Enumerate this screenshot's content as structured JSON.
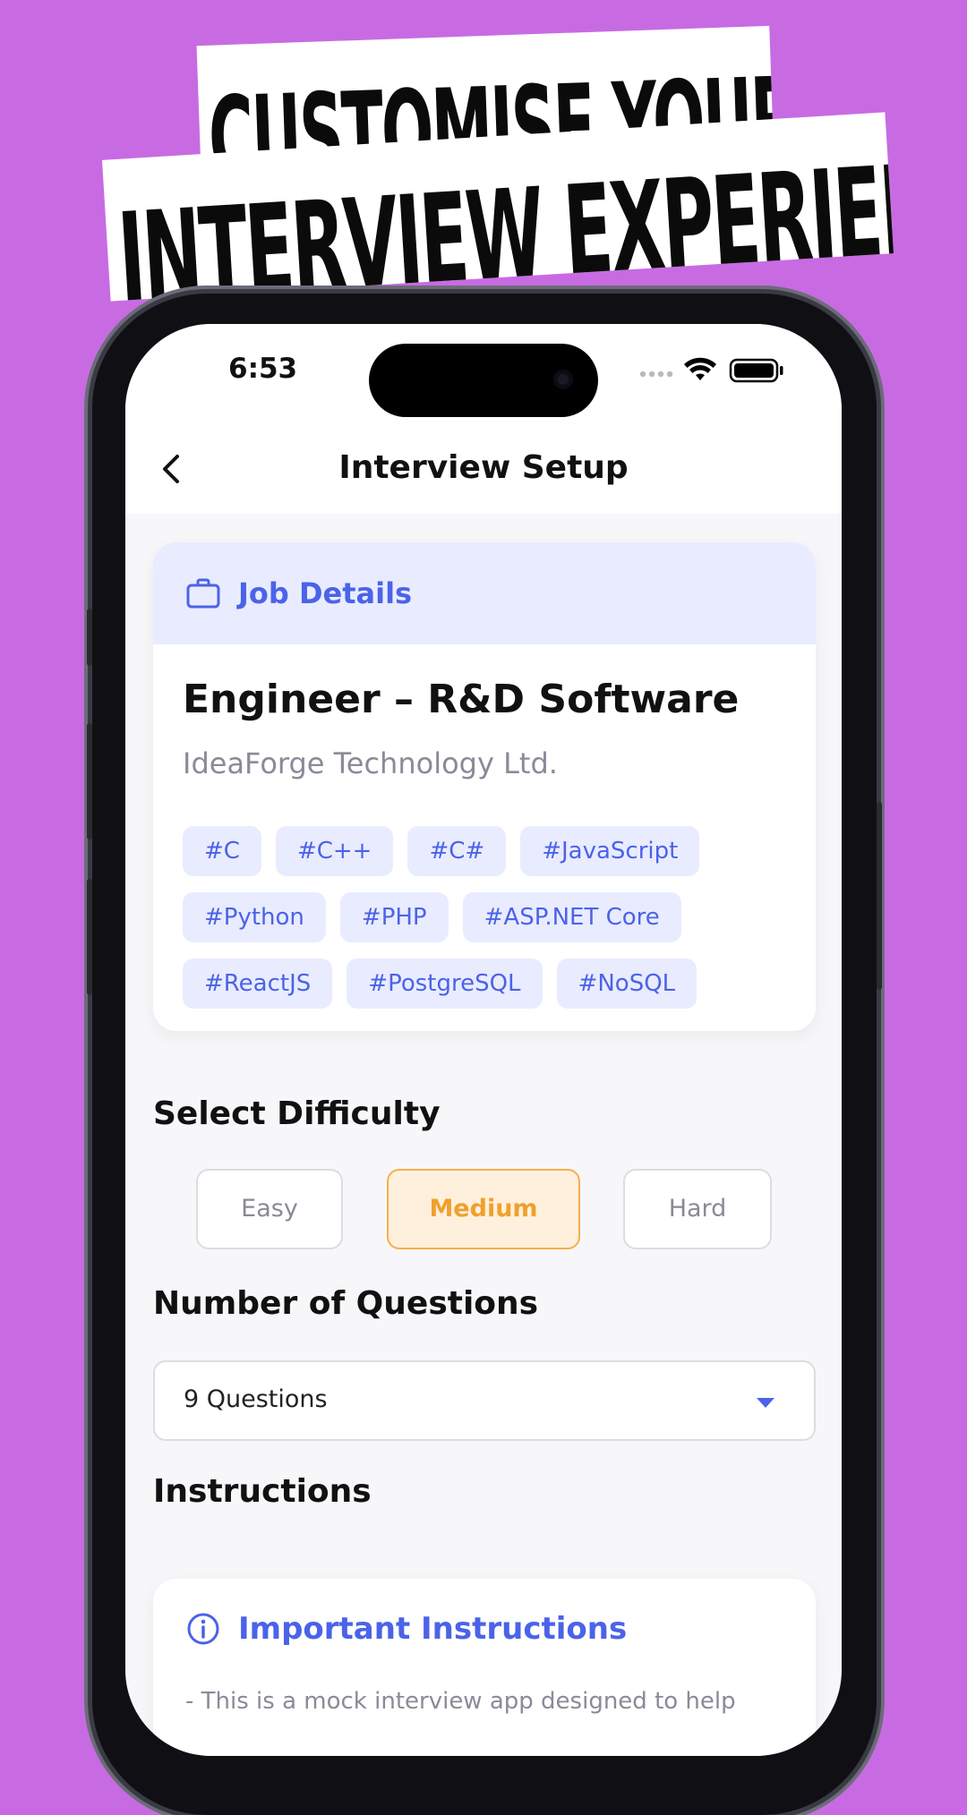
{
  "headline": {
    "line1": "CUSTOMISE YOUR",
    "line2": "INTERVIEW EXPERIENCE"
  },
  "colors": {
    "background": "#c86be3",
    "accent": "#4b63e8",
    "selected": "#f0a02c"
  },
  "status_bar": {
    "time": "6:53",
    "icons": [
      "signal-dots-icon",
      "wifi-icon",
      "battery-icon"
    ]
  },
  "header": {
    "title": "Interview Setup",
    "back_icon": "chevron-left-icon"
  },
  "job_card": {
    "header_label": "Job Details",
    "header_icon": "briefcase-icon",
    "title": "Engineer – R&D Software",
    "company": "IdeaForge Technology Ltd.",
    "tags": [
      "#C",
      "#C++",
      "#C#",
      "#JavaScript",
      "#Python",
      "#PHP",
      "#ASP.NET Core",
      "#ReactJS",
      "#PostgreSQL",
      "#NoSQL"
    ]
  },
  "difficulty": {
    "title": "Select Difficulty",
    "options": [
      "Easy",
      "Medium",
      "Hard"
    ],
    "selected": "Medium"
  },
  "questions": {
    "title": "Number of Questions",
    "selected_value": "9 Questions"
  },
  "instructions": {
    "title": "Instructions",
    "card_title": "Important Instructions",
    "card_icon": "info-icon",
    "text": "- This is a mock interview app designed to help"
  }
}
